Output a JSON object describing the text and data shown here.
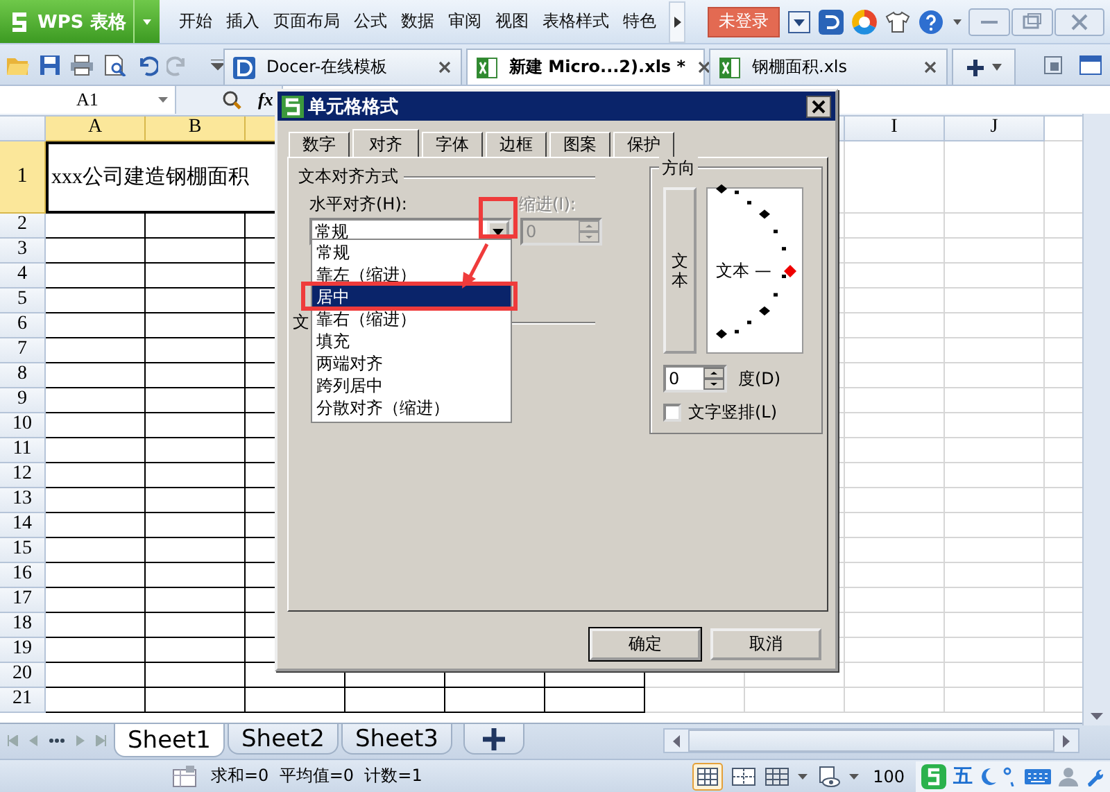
{
  "app_menu": {
    "logo": "WPS 表格",
    "items": [
      "开始",
      "插入",
      "页面布局",
      "公式",
      "数据",
      "审阅",
      "视图",
      "表格样式",
      "特色"
    ],
    "login": "未登录"
  },
  "doc_tabs": [
    {
      "label": "Docer-在线模板",
      "selected": false,
      "kind": "docer"
    },
    {
      "label": "新建 Micro...2).xls *",
      "selected": true,
      "kind": "sheet"
    },
    {
      "label": "钢棚面积.xls",
      "selected": false,
      "kind": "sheet"
    }
  ],
  "formula_bar": {
    "name_box": "A1",
    "fx": "fx"
  },
  "sheet": {
    "columns": [
      {
        "label": "A",
        "selected": true
      },
      {
        "label": "B",
        "selected": true
      },
      {
        "selected": true
      },
      null,
      null,
      null,
      null,
      null,
      {
        "label": "I",
        "selected": false
      },
      {
        "label": "J",
        "selected": false
      }
    ],
    "rows": [
      {
        "label": "1",
        "selected": true
      },
      {
        "label": "2",
        "selected": false
      },
      {
        "label": "3",
        "selected": false
      },
      {
        "label": "4",
        "selected": false
      },
      {
        "label": "5",
        "selected": false
      },
      {
        "label": "6",
        "selected": false
      },
      {
        "label": "7",
        "selected": false
      },
      {
        "label": "8",
        "selected": false
      },
      {
        "label": "9",
        "selected": false
      },
      {
        "label": "10",
        "selected": false
      },
      {
        "label": "11",
        "selected": false
      },
      {
        "label": "12",
        "selected": false
      },
      {
        "label": "13",
        "selected": false
      },
      {
        "label": "14",
        "selected": false
      },
      {
        "label": "15",
        "selected": false
      },
      {
        "label": "16",
        "selected": false
      },
      {
        "label": "17",
        "selected": false
      },
      {
        "label": "18",
        "selected": false
      },
      {
        "label": "19",
        "selected": false
      },
      {
        "label": "20",
        "selected": false
      },
      {
        "label": "21",
        "selected": false
      }
    ],
    "a1": "xxx公司建造钢棚面积"
  },
  "sheet_tabs": [
    {
      "label": "Sheet1",
      "selected": true
    },
    {
      "label": "Sheet2",
      "selected": false
    },
    {
      "label": "Sheet3",
      "selected": false
    }
  ],
  "status_bar": {
    "summary": "求和=0  平均值=0  计数=1",
    "zoom": "100",
    "ime_mode": "五"
  },
  "dialog": {
    "title": "单元格格式",
    "tabs": [
      {
        "label": "数字",
        "selected": false
      },
      {
        "label": "对齐",
        "selected": true
      },
      {
        "label": "字体",
        "selected": false
      },
      {
        "label": "边框",
        "selected": false
      },
      {
        "label": "图案",
        "selected": false
      },
      {
        "label": "保护",
        "selected": false
      }
    ],
    "align_group": "文本对齐方式",
    "horizontal_label": "水平对齐(H):",
    "horizontal_value": "常规",
    "indent_label": "缩进(I):",
    "indent_value": "0",
    "indent_disabled": true,
    "options": [
      {
        "label": "常规",
        "selected": false
      },
      {
        "label": "靠左（缩进）",
        "selected": false
      },
      {
        "label": "居中",
        "selected": true
      },
      {
        "label": "靠右（缩进）",
        "selected": false
      },
      {
        "label": "填充",
        "selected": false
      },
      {
        "label": "两端对齐",
        "selected": false
      },
      {
        "label": "跨列居中",
        "selected": false
      },
      {
        "label": "分散对齐（缩进）",
        "selected": false
      }
    ],
    "control_group": "文",
    "orientation": {
      "label": "方向",
      "vertical_text": "文本",
      "dial_text": "文本 —",
      "degrees": "0",
      "degrees_label": "度(D)",
      "stacked_label": "文字竖排(L)",
      "stacked_checked": false
    },
    "buttons": [
      {
        "label": "确定",
        "default": true
      },
      {
        "label": "取消",
        "default": false
      }
    ]
  }
}
